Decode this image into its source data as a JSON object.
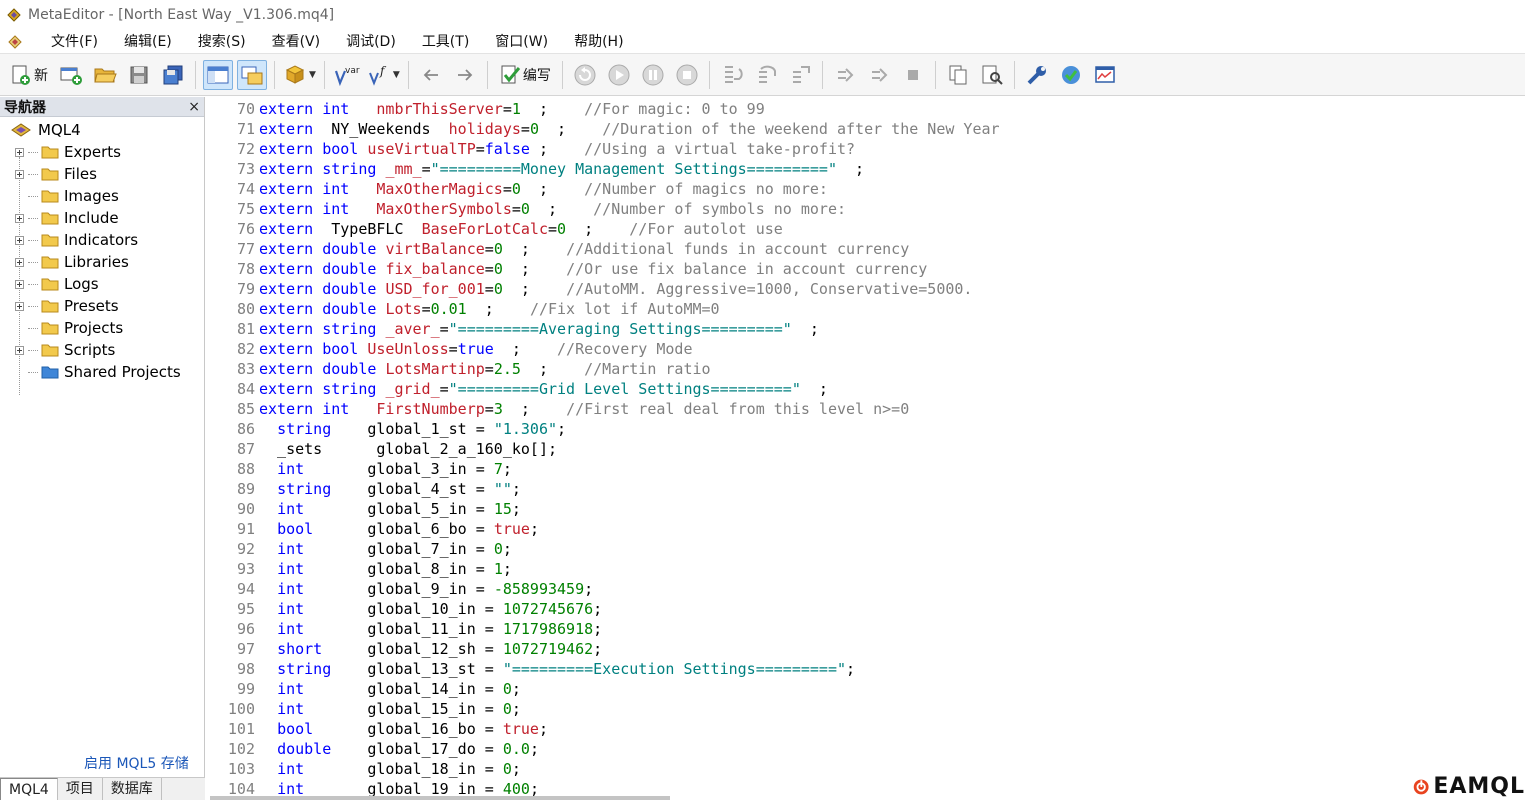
{
  "window": {
    "title": "MetaEditor - [North East Way _V1.306.mq4]"
  },
  "menu": [
    "文件(F)",
    "编辑(E)",
    "搜索(S)",
    "查看(V)",
    "调试(D)",
    "工具(T)",
    "窗口(W)",
    "帮助(H)"
  ],
  "toolbar": {
    "new_label": "新",
    "compile_label": "编写",
    "var_label": "var"
  },
  "navigator": {
    "title": "导航器",
    "close": "×",
    "root": "MQL4",
    "items": [
      {
        "label": "Experts",
        "expandable": true
      },
      {
        "label": "Files",
        "expandable": true
      },
      {
        "label": "Images",
        "expandable": false
      },
      {
        "label": "Include",
        "expandable": true
      },
      {
        "label": "Indicators",
        "expandable": true
      },
      {
        "label": "Libraries",
        "expandable": true
      },
      {
        "label": "Logs",
        "expandable": true
      },
      {
        "label": "Presets",
        "expandable": true
      },
      {
        "label": "Projects",
        "expandable": false
      },
      {
        "label": "Scripts",
        "expandable": true
      },
      {
        "label": "Shared Projects",
        "expandable": false
      }
    ],
    "mql5_link": "启用 MQL5 存储",
    "tabs": [
      "MQL4",
      "项目",
      "数据库"
    ]
  },
  "editor": {
    "lines": [
      {
        "n": "70",
        "t": [
          [
            "kw",
            "extern int   "
          ],
          [
            "id",
            "nmbrThisServer"
          ],
          [
            "tx",
            "="
          ],
          [
            "nm",
            "1"
          ],
          [
            "tx",
            "  ;    "
          ],
          [
            "cm",
            "//For magic: 0 to 99"
          ]
        ]
      },
      {
        "n": "71",
        "t": [
          [
            "kw",
            "extern "
          ],
          [
            "tx",
            " NY_Weekends  "
          ],
          [
            "id",
            "holidays"
          ],
          [
            "tx",
            "="
          ],
          [
            "nm",
            "0"
          ],
          [
            "tx",
            "  ;    "
          ],
          [
            "cm",
            "//Duration of the weekend after the New Year"
          ]
        ]
      },
      {
        "n": "72",
        "t": [
          [
            "kw",
            "extern bool "
          ],
          [
            "id",
            "useVirtualTP"
          ],
          [
            "tx",
            "="
          ],
          [
            "kw",
            "false"
          ],
          [
            "tx",
            " ;    "
          ],
          [
            "cm",
            "//Using a virtual take-profit?"
          ]
        ]
      },
      {
        "n": "73",
        "t": [
          [
            "kw",
            "extern string "
          ],
          [
            "id",
            "_mm_"
          ],
          [
            "tx",
            "="
          ],
          [
            "st",
            "\"=========Money Management Settings=========\""
          ],
          [
            "tx",
            "  ;"
          ]
        ]
      },
      {
        "n": "74",
        "t": [
          [
            "kw",
            "extern int   "
          ],
          [
            "id",
            "MaxOtherMagics"
          ],
          [
            "tx",
            "="
          ],
          [
            "nm",
            "0"
          ],
          [
            "tx",
            "  ;    "
          ],
          [
            "cm",
            "//Number of magics no more:"
          ]
        ]
      },
      {
        "n": "75",
        "t": [
          [
            "kw",
            "extern int   "
          ],
          [
            "id",
            "MaxOtherSymbols"
          ],
          [
            "tx",
            "="
          ],
          [
            "nm",
            "0"
          ],
          [
            "tx",
            "  ;    "
          ],
          [
            "cm",
            "//Number of symbols no more:"
          ]
        ]
      },
      {
        "n": "76",
        "t": [
          [
            "kw",
            "extern "
          ],
          [
            "tx",
            " TypeBFLC  "
          ],
          [
            "id",
            "BaseForLotCalc"
          ],
          [
            "tx",
            "="
          ],
          [
            "nm",
            "0"
          ],
          [
            "tx",
            "  ;    "
          ],
          [
            "cm",
            "//For autolot use"
          ]
        ]
      },
      {
        "n": "77",
        "t": [
          [
            "kw",
            "extern double "
          ],
          [
            "id",
            "virtBalance"
          ],
          [
            "tx",
            "="
          ],
          [
            "nm",
            "0"
          ],
          [
            "tx",
            "  ;    "
          ],
          [
            "cm",
            "//Additional funds in account currency"
          ]
        ]
      },
      {
        "n": "78",
        "t": [
          [
            "kw",
            "extern double "
          ],
          [
            "id",
            "fix_balance"
          ],
          [
            "tx",
            "="
          ],
          [
            "nm",
            "0"
          ],
          [
            "tx",
            "  ;    "
          ],
          [
            "cm",
            "//Or use fix balance in account currency"
          ]
        ]
      },
      {
        "n": "79",
        "t": [
          [
            "kw",
            "extern double "
          ],
          [
            "id",
            "USD_for_001"
          ],
          [
            "tx",
            "="
          ],
          [
            "nm",
            "0"
          ],
          [
            "tx",
            "  ;    "
          ],
          [
            "cm",
            "//AutoMM. Aggressive=1000, Conservative=5000."
          ]
        ]
      },
      {
        "n": "80",
        "t": [
          [
            "kw",
            "extern double "
          ],
          [
            "id",
            "Lots"
          ],
          [
            "tx",
            "="
          ],
          [
            "nm",
            "0.01"
          ],
          [
            "tx",
            "  ;    "
          ],
          [
            "cm",
            "//Fix lot if AutoMM=0"
          ]
        ]
      },
      {
        "n": "81",
        "t": [
          [
            "kw",
            "extern string "
          ],
          [
            "id",
            "_aver_"
          ],
          [
            "tx",
            "="
          ],
          [
            "st",
            "\"=========Averaging Settings=========\""
          ],
          [
            "tx",
            "  ;"
          ]
        ]
      },
      {
        "n": "82",
        "t": [
          [
            "kw",
            "extern bool "
          ],
          [
            "id",
            "UseUnloss"
          ],
          [
            "tx",
            "="
          ],
          [
            "kw",
            "true"
          ],
          [
            "tx",
            "  ;    "
          ],
          [
            "cm",
            "//Recovery Mode"
          ]
        ]
      },
      {
        "n": "83",
        "t": [
          [
            "kw",
            "extern double "
          ],
          [
            "id",
            "LotsMartinp"
          ],
          [
            "tx",
            "="
          ],
          [
            "nm",
            "2.5"
          ],
          [
            "tx",
            "  ;    "
          ],
          [
            "cm",
            "//Martin ratio"
          ]
        ]
      },
      {
        "n": "84",
        "t": [
          [
            "kw",
            "extern string "
          ],
          [
            "id",
            "_grid_"
          ],
          [
            "tx",
            "="
          ],
          [
            "st",
            "\"=========Grid Level Settings=========\""
          ],
          [
            "tx",
            "  ;"
          ]
        ]
      },
      {
        "n": "85",
        "t": [
          [
            "kw",
            "extern int   "
          ],
          [
            "id",
            "FirstNumberp"
          ],
          [
            "tx",
            "="
          ],
          [
            "nm",
            "3"
          ],
          [
            "tx",
            "  ;    "
          ],
          [
            "cm",
            "//First real deal from this level n>=0"
          ]
        ]
      },
      {
        "n": "86",
        "t": [
          [
            "tx",
            "  "
          ],
          [
            "kw",
            "string"
          ],
          [
            "tx",
            "    global_1_st = "
          ],
          [
            "st",
            "\"1.306\""
          ],
          [
            "tx",
            ";"
          ]
        ]
      },
      {
        "n": "87",
        "t": [
          [
            "tx",
            "  _sets      global_2_a_160_ko[];"
          ]
        ]
      },
      {
        "n": "88",
        "t": [
          [
            "tx",
            "  "
          ],
          [
            "kw",
            "int"
          ],
          [
            "tx",
            "       global_3_in = "
          ],
          [
            "nm",
            "7"
          ],
          [
            "tx",
            ";"
          ]
        ]
      },
      {
        "n": "89",
        "t": [
          [
            "tx",
            "  "
          ],
          [
            "kw",
            "string"
          ],
          [
            "tx",
            "    global_4_st = "
          ],
          [
            "st",
            "\"\""
          ],
          [
            "tx",
            ";"
          ]
        ]
      },
      {
        "n": "90",
        "t": [
          [
            "tx",
            "  "
          ],
          [
            "kw",
            "int"
          ],
          [
            "tx",
            "       global_5_in = "
          ],
          [
            "nm",
            "15"
          ],
          [
            "tx",
            ";"
          ]
        ]
      },
      {
        "n": "91",
        "t": [
          [
            "tx",
            "  "
          ],
          [
            "kw",
            "bool"
          ],
          [
            "tx",
            "      global_6_bo = "
          ],
          [
            "id",
            "true"
          ],
          [
            "tx",
            ";"
          ]
        ]
      },
      {
        "n": "92",
        "t": [
          [
            "tx",
            "  "
          ],
          [
            "kw",
            "int"
          ],
          [
            "tx",
            "       global_7_in = "
          ],
          [
            "nm",
            "0"
          ],
          [
            "tx",
            ";"
          ]
        ]
      },
      {
        "n": "93",
        "t": [
          [
            "tx",
            "  "
          ],
          [
            "kw",
            "int"
          ],
          [
            "tx",
            "       global_8_in = "
          ],
          [
            "nm",
            "1"
          ],
          [
            "tx",
            ";"
          ]
        ]
      },
      {
        "n": "94",
        "t": [
          [
            "tx",
            "  "
          ],
          [
            "kw",
            "int"
          ],
          [
            "tx",
            "       global_9_in = "
          ],
          [
            "nm",
            "-858993459"
          ],
          [
            "tx",
            ";"
          ]
        ]
      },
      {
        "n": "95",
        "t": [
          [
            "tx",
            "  "
          ],
          [
            "kw",
            "int"
          ],
          [
            "tx",
            "       global_10_in = "
          ],
          [
            "nm",
            "1072745676"
          ],
          [
            "tx",
            ";"
          ]
        ]
      },
      {
        "n": "96",
        "t": [
          [
            "tx",
            "  "
          ],
          [
            "kw",
            "int"
          ],
          [
            "tx",
            "       global_11_in = "
          ],
          [
            "nm",
            "1717986918"
          ],
          [
            "tx",
            ";"
          ]
        ]
      },
      {
        "n": "97",
        "t": [
          [
            "tx",
            "  "
          ],
          [
            "kw",
            "short"
          ],
          [
            "tx",
            "     global_12_sh = "
          ],
          [
            "nm",
            "1072719462"
          ],
          [
            "tx",
            ";"
          ]
        ]
      },
      {
        "n": "98",
        "t": [
          [
            "tx",
            "  "
          ],
          [
            "kw",
            "string"
          ],
          [
            "tx",
            "    global_13_st = "
          ],
          [
            "st",
            "\"=========Execution Settings=========\""
          ],
          [
            "tx",
            ";"
          ]
        ]
      },
      {
        "n": "99",
        "t": [
          [
            "tx",
            "  "
          ],
          [
            "kw",
            "int"
          ],
          [
            "tx",
            "       global_14_in = "
          ],
          [
            "nm",
            "0"
          ],
          [
            "tx",
            ";"
          ]
        ]
      },
      {
        "n": "100",
        "t": [
          [
            "tx",
            "  "
          ],
          [
            "kw",
            "int"
          ],
          [
            "tx",
            "       global_15_in = "
          ],
          [
            "nm",
            "0"
          ],
          [
            "tx",
            ";"
          ]
        ]
      },
      {
        "n": "101",
        "t": [
          [
            "tx",
            "  "
          ],
          [
            "kw",
            "bool"
          ],
          [
            "tx",
            "      global_16_bo = "
          ],
          [
            "id",
            "true"
          ],
          [
            "tx",
            ";"
          ]
        ]
      },
      {
        "n": "102",
        "t": [
          [
            "tx",
            "  "
          ],
          [
            "kw",
            "double"
          ],
          [
            "tx",
            "    global_17_do = "
          ],
          [
            "nm",
            "0.0"
          ],
          [
            "tx",
            ";"
          ]
        ]
      },
      {
        "n": "103",
        "t": [
          [
            "tx",
            "  "
          ],
          [
            "kw",
            "int"
          ],
          [
            "tx",
            "       global_18_in = "
          ],
          [
            "nm",
            "0"
          ],
          [
            "tx",
            ";"
          ]
        ]
      },
      {
        "n": "104",
        "t": [
          [
            "tx",
            "  "
          ],
          [
            "kw",
            "int"
          ],
          [
            "tx",
            "       global_19_in = "
          ],
          [
            "nm",
            "400"
          ],
          [
            "tx",
            ";"
          ]
        ]
      }
    ]
  },
  "watermark": {
    "text": "EAMQL"
  },
  "colors": {
    "keyword": "#0000ff",
    "identifier": "#c0202c",
    "comment": "#808080",
    "string": "#008080",
    "number": "#008000"
  }
}
